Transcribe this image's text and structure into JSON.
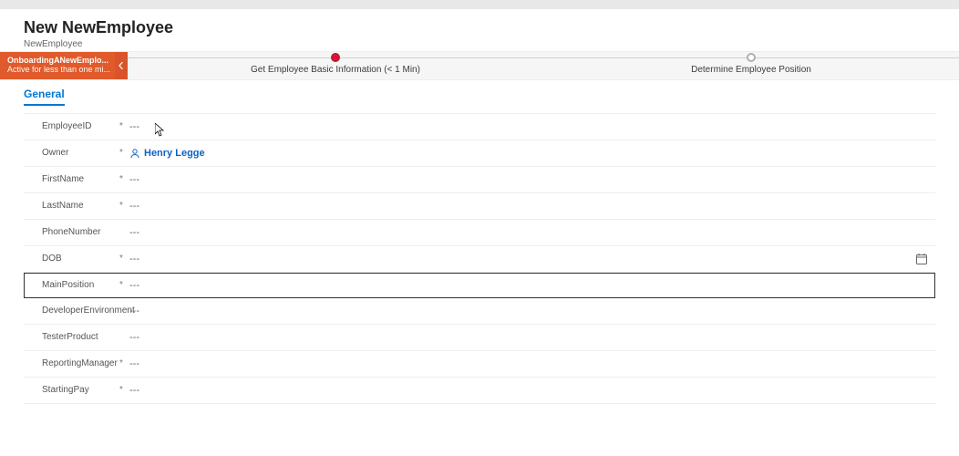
{
  "header": {
    "title": "New NewEmployee",
    "subtitle": "NewEmployee"
  },
  "process": {
    "chip_title": "OnboardingANewEmplo...",
    "chip_sub": "Active for less than one mi...",
    "stages": [
      {
        "label": "Get Employee Basic Information",
        "time": "(< 1 Min)",
        "state": "active"
      },
      {
        "label": "Determine Employee Position",
        "time": "",
        "state": "future"
      }
    ]
  },
  "tabs": [
    {
      "label": "General",
      "selected": true
    }
  ],
  "placeholder": "---",
  "fields": [
    {
      "key": "employeeid",
      "label": "EmployeeID",
      "required": true,
      "value": "---",
      "type": "text"
    },
    {
      "key": "owner",
      "label": "Owner",
      "required": true,
      "value": "Henry Legge",
      "type": "lookup-person"
    },
    {
      "key": "firstname",
      "label": "FirstName",
      "required": true,
      "value": "---",
      "type": "text"
    },
    {
      "key": "lastname",
      "label": "LastName",
      "required": true,
      "value": "---",
      "type": "text"
    },
    {
      "key": "phonenumber",
      "label": "PhoneNumber",
      "required": false,
      "value": "---",
      "type": "text"
    },
    {
      "key": "dob",
      "label": "DOB",
      "required": true,
      "value": "---",
      "type": "date"
    },
    {
      "key": "mainposition",
      "label": "MainPosition",
      "required": true,
      "value": "---",
      "type": "text",
      "selected": true
    },
    {
      "key": "devenv",
      "label": "DeveloperEnvironment",
      "required": false,
      "value": "---",
      "type": "text"
    },
    {
      "key": "testerproduct",
      "label": "TesterProduct",
      "required": false,
      "value": "---",
      "type": "text"
    },
    {
      "key": "reportingmanager",
      "label": "ReportingManager",
      "required": true,
      "value": "---",
      "type": "text"
    },
    {
      "key": "startingpay",
      "label": "StartingPay",
      "required": true,
      "value": "---",
      "type": "text"
    }
  ]
}
